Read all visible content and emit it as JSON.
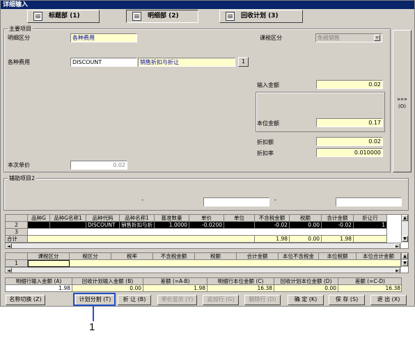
{
  "window": {
    "title": "详细输入"
  },
  "tabs": [
    {
      "label": "标题部 (1)"
    },
    {
      "label": "明细部 (2)"
    },
    {
      "label": "回收计划 (3)"
    }
  ],
  "main": {
    "group_label": "主要项目",
    "detail_type_label": "明细区分",
    "detail_type_value": "各种费用",
    "tax_type_label": "课税区分",
    "tax_type_value": "免税销售",
    "expense_label": "各种费用",
    "expense_code": "DISCOUNT",
    "expense_name": "销售折扣与折让",
    "expense_lookup": "1",
    "input_amount_label": "输入金额",
    "input_amount_value": "0.02",
    "base_amount_label": "本位金额",
    "base_amount_value": "0.17",
    "discount_amount_label": "折扣额",
    "discount_amount_value": "0.02",
    "discount_rate_label": "折扣率",
    "discount_rate_value": "0.010000",
    "unit_price_label": "本次单价",
    "unit_price_value": "0.02",
    "side_button": "»»»",
    "side_button_sub": "(O)"
  },
  "aux": {
    "group_label": "辅助项目2",
    "dash1": "-",
    "dash2": "-"
  },
  "grid1": {
    "headers": [
      "",
      "品种G",
      "品种G名称1",
      "品种代码",
      "品种名称1",
      "基准数量",
      "单价",
      "单位",
      "不含税金额",
      "税额",
      "含计金额",
      "折让行"
    ],
    "rows": [
      {
        "no": "2",
        "cells": [
          "",
          "",
          "DISCOUNT",
          "销售折扣与折",
          "1.0000",
          "-0.0200",
          "",
          "-0.02",
          "0.00",
          "-0.02",
          "1"
        ]
      },
      {
        "no": "3",
        "cells": [
          "",
          "",
          "",
          "",
          "",
          "",
          "",
          "",
          "",
          "",
          ""
        ]
      }
    ],
    "sum": {
      "no": "合计",
      "cells": [
        "",
        "",
        "",
        "",
        "",
        "",
        "",
        "1.98",
        "0.00",
        "1.98",
        ""
      ]
    }
  },
  "grid2": {
    "headers": [
      "",
      "课税区分",
      "税区分",
      "税率",
      "不含税金额",
      "税额",
      "合计金额",
      "本位不含税金",
      "本位税额",
      "本位合计金额"
    ],
    "rows": [
      {
        "no": "1",
        "cells": [
          "",
          "",
          "",
          "",
          "",
          "",
          "",
          "",
          ""
        ]
      }
    ]
  },
  "summary": {
    "headers": [
      "明细行输入金额 (A)",
      "回收计划输入金额 (B)",
      "差额 (=A-B)",
      "明细行本位金额 (C)",
      "回收计划本位金额 (D)",
      "差额 (=C-D)"
    ],
    "values": [
      "1.98",
      "0.00",
      "1.98",
      "16.38",
      "0.00",
      "16.38"
    ]
  },
  "buttons": {
    "name_switch": "名称切换 (Z)",
    "plan_split": "计划分割 (T)",
    "discount": "折  让 (B)",
    "unit_price_display": "单价显示 (Y)",
    "add_row": "追加行 (G)",
    "delete_row": "删除行 (D)",
    "confirm": "确  定 (K)",
    "save": "保  存 (S)",
    "exit": "退  出 (X)"
  },
  "callout": {
    "number": "1"
  }
}
